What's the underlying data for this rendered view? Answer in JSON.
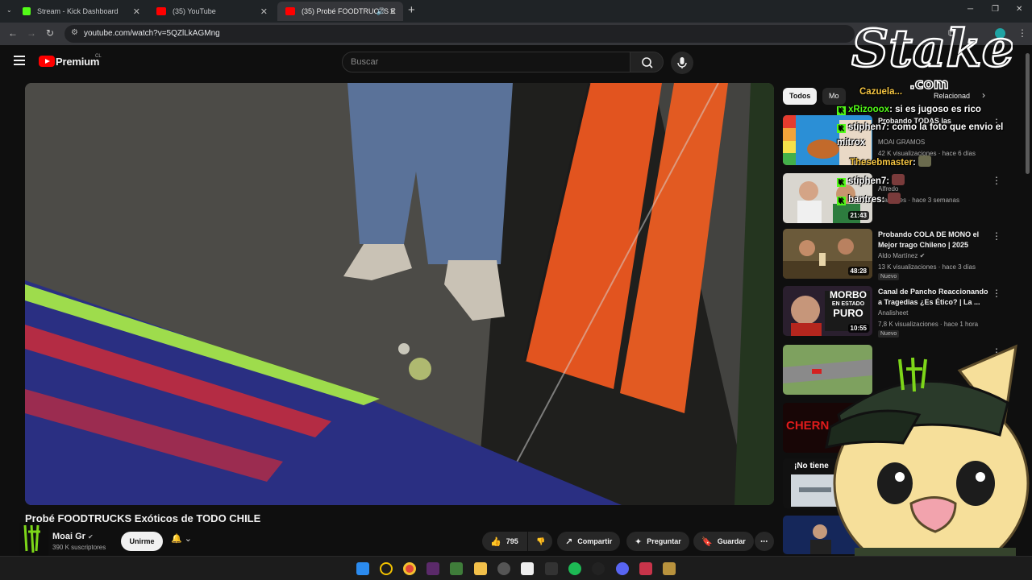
{
  "browser": {
    "tabs": [
      {
        "label": "Stream - Kick Dashboard"
      },
      {
        "label": "(35) YouTube"
      },
      {
        "label": "(35) Probé FOODTRUCKS E"
      }
    ],
    "url": "youtube.com/watch?v=5QZlLkAGMng"
  },
  "yt": {
    "brand": "Premium",
    "region": "CL",
    "search_placeholder": "Buscar"
  },
  "video": {
    "title": "Probé FOODTRUCKS Exóticos de TODO CHILE",
    "channel": "Moai Gr",
    "subscribers": "390 K suscriptores",
    "join_label": "Unirme",
    "likes": "795",
    "share_label": "Compartir",
    "ask_label": "Preguntar",
    "save_label": "Guardar"
  },
  "sidebar": {
    "chips": [
      "Todos",
      "Mo",
      "Relacionad"
    ],
    "recs": [
      {
        "title": "Probando TODAS las",
        "channel": "MOAI GRAMOS",
        "meta": "42 K visualizaciones · hace 6 días",
        "duration": "",
        "badge": ""
      },
      {
        "title": "",
        "channel": "Alfredo",
        "meta": "lizaciones · hace 3 semanas",
        "duration": "21:43",
        "badge": ""
      },
      {
        "title": "Probando COLA DE MONO el Mejor trago Chileno | 2025",
        "channel": "Aldo Martínez",
        "meta": "13 K visualizaciones · hace 3 días",
        "duration": "48:28",
        "badge": "Nuevo"
      },
      {
        "title": "Canal de Pancho Reaccionando a Tragedias ¿Es Ético? | La ...",
        "channel": "Analisheet",
        "meta": "7,8 K visualizaciones · hace 1 hora",
        "duration": "10:55",
        "badge": "Nuevo"
      }
    ],
    "thumb_text": {
      "morbo1": "MORBO",
      "morbo2": "EN ESTADO",
      "morbo3": "PURO",
      "cherno": "CHERN",
      "notiene": "¡No tiene"
    }
  },
  "chat": [
    {
      "user": "Cazuela...",
      "user_color": "#f5c542",
      "msg": ""
    },
    {
      "user": "xRizooox",
      "user_color": "#53fc18",
      "msg": ": si es jugoso es rico"
    },
    {
      "user": "stiphen7",
      "user_color": "#ffffff",
      "msg": ": como la foto que envio el"
    },
    {
      "user": "",
      "user_color": "#ffffff",
      "msg": "mitrox"
    },
    {
      "user": "Thesebmaster",
      "user_color": "#f5c542",
      "msg": ":"
    },
    {
      "user": "stiphen7",
      "user_color": "#ffffff",
      "msg": ":"
    },
    {
      "user": "bantres",
      "user_color": "#ffffff",
      "msg": ":"
    }
  ],
  "overlay": {
    "stake_brand": "Stake",
    "stake_domain": ".com"
  },
  "colors": {
    "yt_red": "#ff0000",
    "kick_green": "#53fc18",
    "bg": "#0f0f0f"
  }
}
